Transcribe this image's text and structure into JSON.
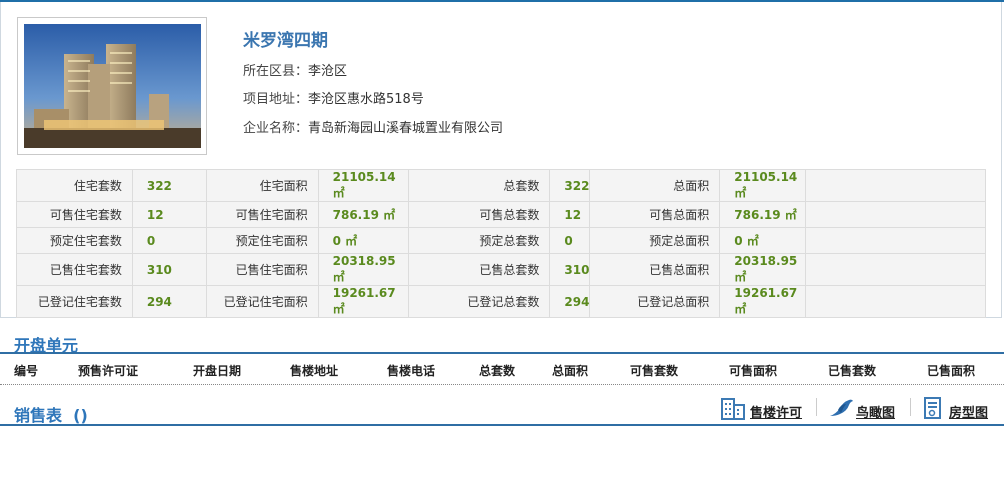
{
  "project": {
    "name": "米罗湾四期",
    "district_label": "所在区县：",
    "district": "李沧区",
    "address_label": "项目地址：",
    "address": "李沧区惠水路518号",
    "company_label": "企业名称：",
    "company": "青岛新海园山溪春城置业有限公司"
  },
  "stats": [
    [
      {
        "label": "住宅套数",
        "value": "322"
      },
      {
        "label": "住宅面积",
        "value": "21105.14 ㎡"
      },
      {
        "label": "总套数",
        "value": "322"
      },
      {
        "label": "总面积",
        "value": "21105.14 ㎡"
      }
    ],
    [
      {
        "label": "可售住宅套数",
        "value": "12"
      },
      {
        "label": "可售住宅面积",
        "value": "786.19 ㎡"
      },
      {
        "label": "可售总套数",
        "value": "12"
      },
      {
        "label": "可售总面积",
        "value": "786.19 ㎡"
      }
    ],
    [
      {
        "label": "预定住宅套数",
        "value": "0"
      },
      {
        "label": "预定住宅面积",
        "value": "0 ㎡"
      },
      {
        "label": "预定总套数",
        "value": "0"
      },
      {
        "label": "预定总面积",
        "value": "0 ㎡"
      }
    ],
    [
      {
        "label": "已售住宅套数",
        "value": "310"
      },
      {
        "label": "已售住宅面积",
        "value": "20318.95 ㎡"
      },
      {
        "label": "已售总套数",
        "value": "310"
      },
      {
        "label": "已售总面积",
        "value": "20318.95 ㎡"
      }
    ],
    [
      {
        "label": "已登记住宅套数",
        "value": "294"
      },
      {
        "label": "已登记住宅面积",
        "value": "19261.67 ㎡"
      },
      {
        "label": "已登记总套数",
        "value": "294"
      },
      {
        "label": "已登记总面积",
        "value": "19261.67 ㎡"
      }
    ]
  ],
  "units_section": {
    "title": "开盘单元",
    "columns": [
      "编号",
      "预售许可证",
      "开盘日期",
      "售楼地址",
      "售楼电话",
      "总套数",
      "总面积",
      "可售套数",
      "可售面积",
      "已售套数",
      "已售面积"
    ]
  },
  "sales_section": {
    "title": "销售表",
    "suffix": "()",
    "tools": [
      {
        "label": "售楼许可",
        "icon": "building-icon"
      },
      {
        "label": "鸟瞰图",
        "icon": "bird-icon"
      },
      {
        "label": "房型图",
        "icon": "document-icon"
      }
    ]
  },
  "colors": {
    "accent": "#2e76ba",
    "value_green": "#5a8a1e",
    "line": "#2f6ea4"
  }
}
